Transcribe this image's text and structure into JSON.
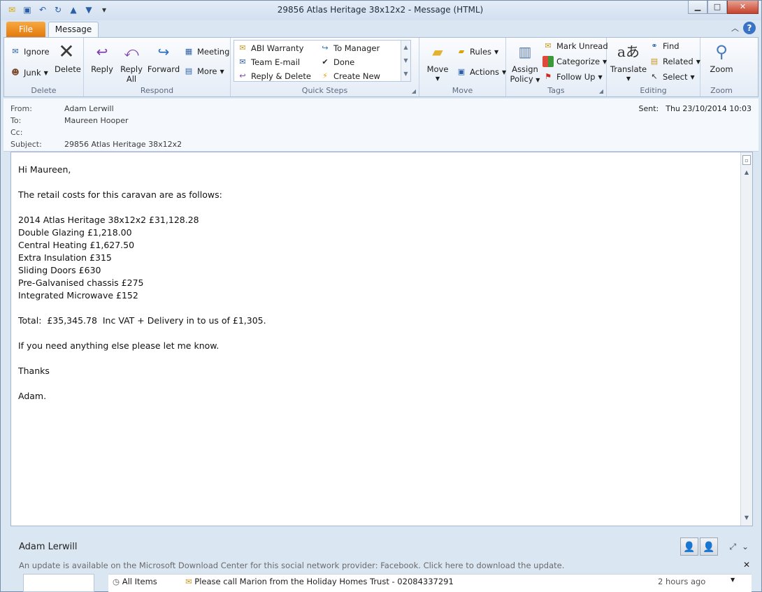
{
  "window": {
    "title": "29856 Atlas Heritage 38x12x2  -  Message (HTML)"
  },
  "tabs": {
    "file": "File",
    "message": "Message"
  },
  "ribbon": {
    "delete": {
      "label": "Delete",
      "ignore": "Ignore",
      "junk": "Junk",
      "delete_btn": "Delete"
    },
    "respond": {
      "label": "Respond",
      "reply": "Reply",
      "reply_all_1": "Reply",
      "reply_all_2": "All",
      "forward": "Forward",
      "meeting": "Meeting",
      "more": "More"
    },
    "quick_steps": {
      "label": "Quick Steps",
      "items": [
        "ABI Warranty",
        "Team E-mail",
        "Reply & Delete",
        "To Manager",
        "Done",
        "Create New"
      ]
    },
    "move": {
      "label": "Move",
      "move_btn": "Move",
      "rules": "Rules",
      "actions": "Actions"
    },
    "tags": {
      "label": "Tags",
      "assign_1": "Assign",
      "assign_2": "Policy",
      "mark_unread": "Mark Unread",
      "categorize": "Categorize",
      "follow_up": "Follow Up"
    },
    "editing": {
      "label": "Editing",
      "translate": "Translate",
      "find": "Find",
      "related": "Related",
      "select": "Select"
    },
    "zoom": {
      "label": "Zoom",
      "zoom_btn": "Zoom"
    }
  },
  "header": {
    "from_label": "From:",
    "from": "Adam Lerwill",
    "to_label": "To:",
    "to": "Maureen Hooper",
    "cc_label": "Cc:",
    "cc": "",
    "subject_label": "Subject:",
    "subject": "29856 Atlas Heritage 38x12x2",
    "sent_label": "Sent:",
    "sent": "Thu 23/10/2014 10:03"
  },
  "body": {
    "lines": [
      "Hi Maureen,",
      "",
      "The retail costs for this caravan are as follows:",
      "",
      "2014 Atlas Heritage 38x12x2 £31,128.28",
      "Double Glazing £1,218.00",
      "Central Heating £1,627.50",
      "Extra Insulation £315",
      "Sliding Doors £630",
      "Pre-Galvanised chassis £275",
      "Integrated Microwave £152",
      "",
      "Total:  £35,345.78  Inc VAT + Delivery in to us of £1,305.",
      "",
      "If you need anything else please let me know.",
      "",
      "Thanks",
      "",
      "Adam."
    ]
  },
  "people_pane": {
    "name": "Adam Lerwill",
    "update_notice": "An update is available on the Microsoft Download Center for this social network provider: Facebook. Click here to download the update.",
    "feed_filter": "All Items",
    "feed_item": "Please call Marion from the Holiday Homes Trust - 02084337291",
    "feed_time": "2 hours ago"
  }
}
